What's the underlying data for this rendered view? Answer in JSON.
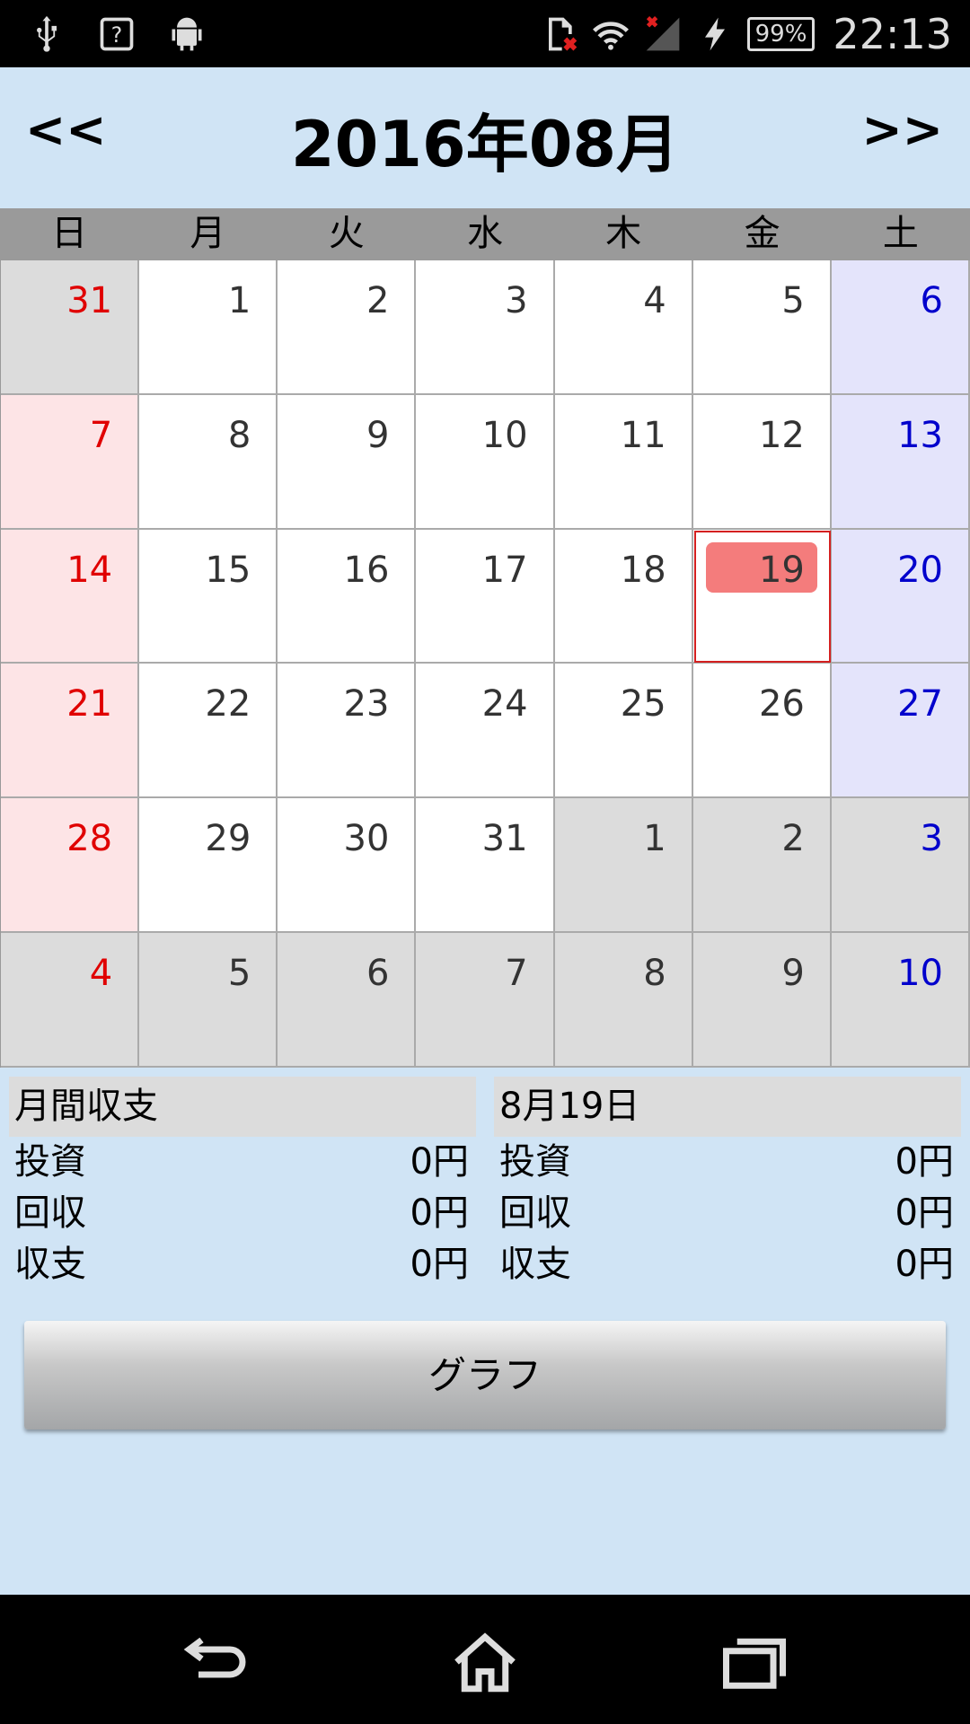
{
  "status_bar": {
    "icons_left": [
      "usb-icon",
      "unknown-notification-icon",
      "android-debug-icon"
    ],
    "icons_right": [
      "sd-card-error-icon",
      "wifi-icon",
      "cellular-signal-icon",
      "charging-icon"
    ],
    "battery": "99%",
    "time": "22:13"
  },
  "header": {
    "prev_label": "<<",
    "title": "2016年08月",
    "next_label": ">>"
  },
  "weekdays": [
    "日",
    "月",
    "火",
    "水",
    "木",
    "金",
    "土"
  ],
  "colors": {
    "sunday": "#e00000",
    "saturday": "#0000cc",
    "today_highlight": "#f47c7c",
    "background": "#d0e4f5"
  },
  "calendar": {
    "today": "19",
    "weeks": [
      [
        {
          "d": "31",
          "o": true
        },
        {
          "d": "1"
        },
        {
          "d": "2"
        },
        {
          "d": "3"
        },
        {
          "d": "4"
        },
        {
          "d": "5"
        },
        {
          "d": "6"
        }
      ],
      [
        {
          "d": "7"
        },
        {
          "d": "8"
        },
        {
          "d": "9"
        },
        {
          "d": "10"
        },
        {
          "d": "11"
        },
        {
          "d": "12"
        },
        {
          "d": "13"
        }
      ],
      [
        {
          "d": "14"
        },
        {
          "d": "15"
        },
        {
          "d": "16"
        },
        {
          "d": "17"
        },
        {
          "d": "18"
        },
        {
          "d": "19",
          "t": true
        },
        {
          "d": "20"
        }
      ],
      [
        {
          "d": "21"
        },
        {
          "d": "22"
        },
        {
          "d": "23"
        },
        {
          "d": "24"
        },
        {
          "d": "25"
        },
        {
          "d": "26"
        },
        {
          "d": "27"
        }
      ],
      [
        {
          "d": "28"
        },
        {
          "d": "29"
        },
        {
          "d": "30"
        },
        {
          "d": "31"
        },
        {
          "d": "1",
          "o": true
        },
        {
          "d": "2",
          "o": true
        },
        {
          "d": "3",
          "o": true
        }
      ],
      [
        {
          "d": "4",
          "o": true
        },
        {
          "d": "5",
          "o": true
        },
        {
          "d": "6",
          "o": true
        },
        {
          "d": "7",
          "o": true
        },
        {
          "d": "8",
          "o": true
        },
        {
          "d": "9",
          "o": true
        },
        {
          "d": "10",
          "o": true
        }
      ]
    ]
  },
  "monthly_summary": {
    "title": "月間収支",
    "rows": [
      {
        "label": "投資",
        "value": "0円"
      },
      {
        "label": "回収",
        "value": "0円"
      },
      {
        "label": "収支",
        "value": "0円"
      }
    ]
  },
  "daily_summary": {
    "title": "8月19日",
    "rows": [
      {
        "label": "投資",
        "value": "0円"
      },
      {
        "label": "回収",
        "value": "0円"
      },
      {
        "label": "収支",
        "value": "0円"
      }
    ]
  },
  "graph_button": "グラフ",
  "nav_bar": {
    "icons": [
      "back-icon",
      "home-icon",
      "recent-apps-icon"
    ]
  }
}
